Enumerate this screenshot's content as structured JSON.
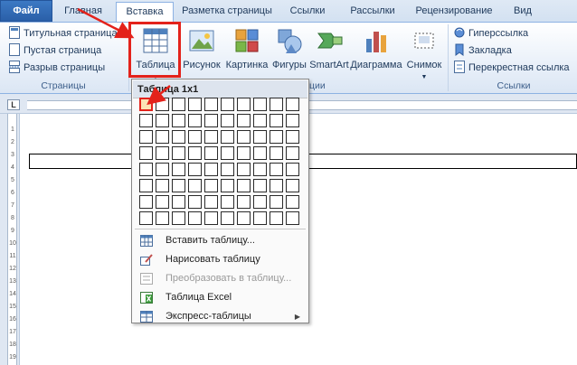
{
  "tabs": [
    "Файл",
    "Главная",
    "Вставка",
    "Разметка страницы",
    "Ссылки",
    "Рассылки",
    "Рецензирование",
    "Вид"
  ],
  "ribbon": {
    "pages": {
      "items": [
        "Титульная страница",
        "Пустая страница",
        "Разрыв страницы"
      ],
      "label": "Страницы"
    },
    "table_btn": "Таблица",
    "illustrations": {
      "items": [
        "Рисунок",
        "Картинка",
        "Фигуры",
        "SmartArt",
        "Диаграмма",
        "Снимок"
      ],
      "label": "страции"
    },
    "links": {
      "items": [
        "Гиперссылка",
        "Закладка",
        "Перекрестная ссылка"
      ],
      "label": "Ссылки"
    }
  },
  "ruler": {
    "corner": "L",
    "vertical_numbers": [
      "1",
      "2",
      "3",
      "4",
      "5",
      "6",
      "7",
      "8",
      "9",
      "10",
      "11",
      "12",
      "13",
      "14",
      "15",
      "16",
      "17",
      "18",
      "19"
    ]
  },
  "dropdown": {
    "header": "Таблица 1x1",
    "grid_cols": 10,
    "grid_rows": 8,
    "selected_cols": 1,
    "selected_rows": 1,
    "items": [
      {
        "label": "Вставить таблицу...",
        "icon": "insert-table-icon",
        "disabled": false
      },
      {
        "label": "Нарисовать таблицу",
        "icon": "draw-table-icon",
        "disabled": false
      },
      {
        "label": "Преобразовать в таблицу...",
        "icon": "convert-table-icon",
        "disabled": true
      },
      {
        "label": "Таблица Excel",
        "icon": "excel-table-icon",
        "disabled": false
      },
      {
        "label": "Экспресс-таблицы",
        "icon": "quick-tables-icon",
        "disabled": false,
        "submenu": true
      }
    ]
  },
  "colors": {
    "highlight": "#e3221b",
    "file_tab": "#2a5fa8",
    "ribbon_text": "#1e395b"
  }
}
